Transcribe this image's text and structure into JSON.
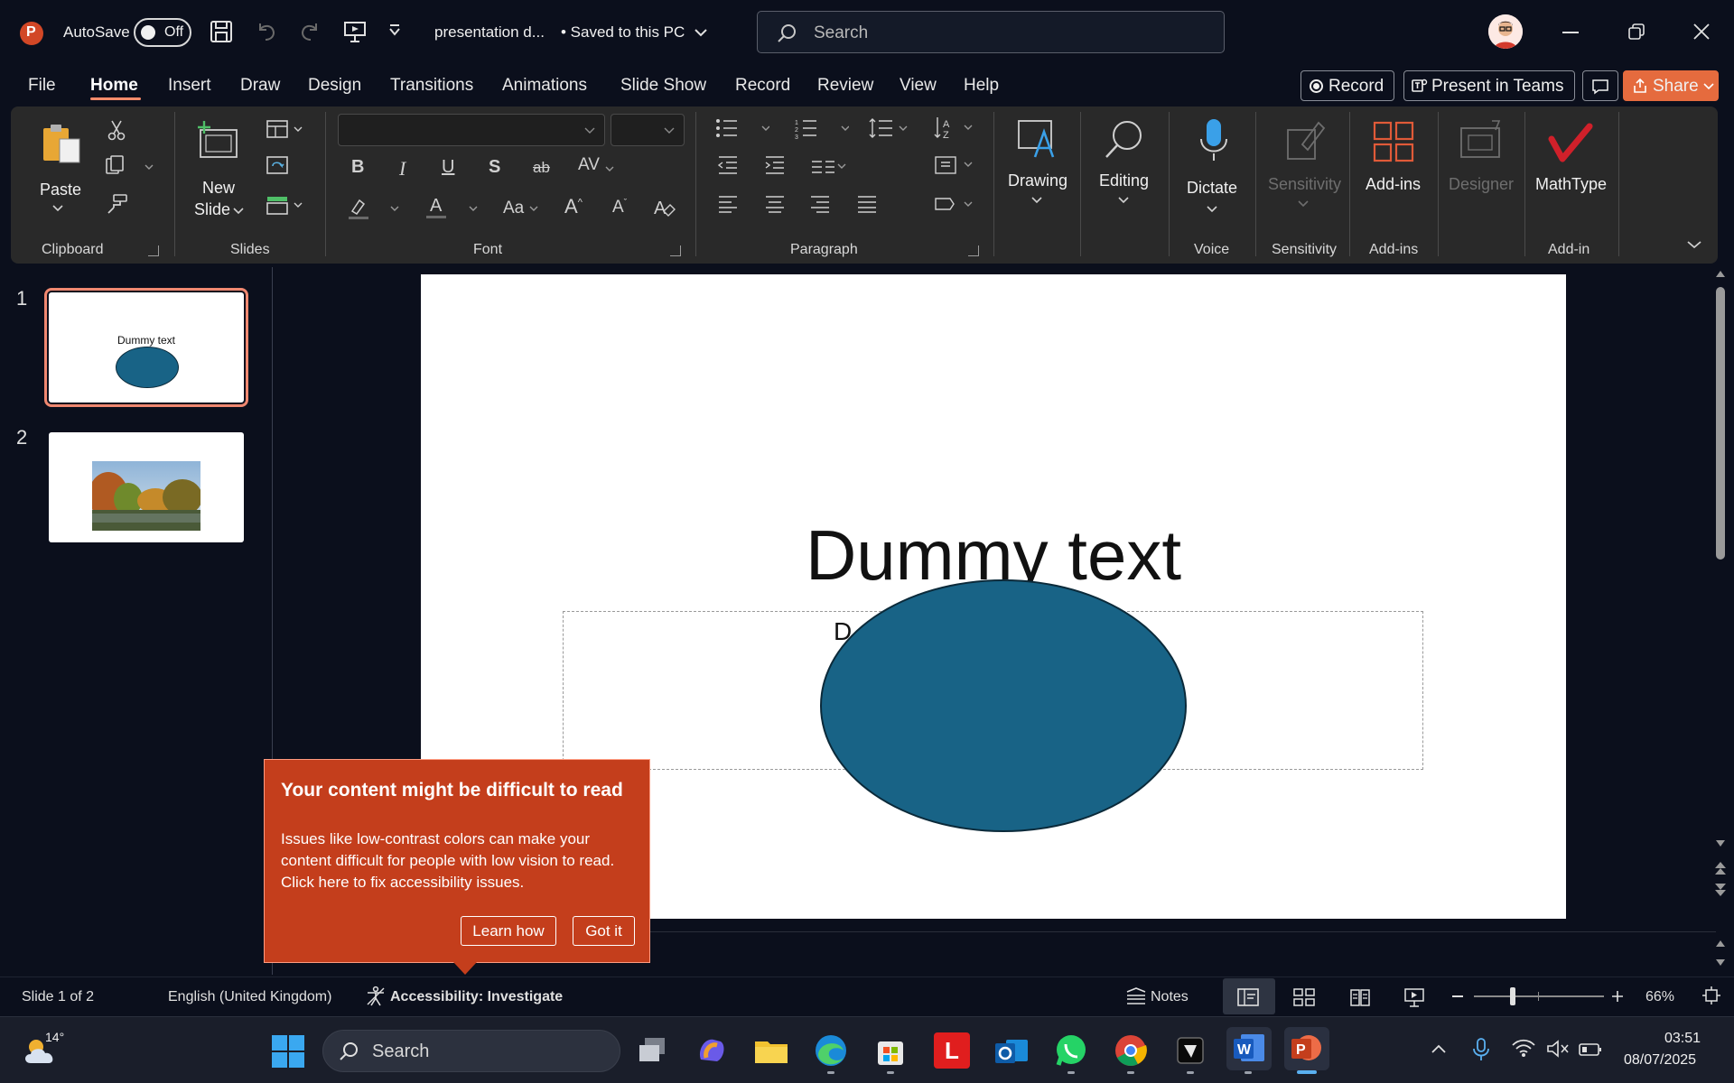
{
  "titlebar": {
    "autosave_label": "AutoSave",
    "autosave_state": "Off",
    "doc_title": "presentation d...",
    "save_status": "• Saved to this PC",
    "search_placeholder": "Search"
  },
  "menu": {
    "items": [
      "File",
      "Home",
      "Insert",
      "Draw",
      "Design",
      "Transitions",
      "Animations",
      "Slide Show",
      "Record",
      "Review",
      "View",
      "Help"
    ],
    "active": "Home",
    "record_button": "Record",
    "present_teams_button": "Present in Teams",
    "share_button": "Share"
  },
  "ribbon": {
    "paste": "Paste",
    "new_slide_line1": "New",
    "new_slide_line2": "Slide",
    "drawing": "Drawing",
    "editing": "Editing",
    "dictate": "Dictate",
    "sensitivity": "Sensitivity",
    "addins": "Add-ins",
    "designer": "Designer",
    "mathtype": "MathType",
    "groups": {
      "clipboard": "Clipboard",
      "slides": "Slides",
      "font": "Font",
      "paragraph": "Paragraph",
      "voice": "Voice",
      "sensitivity": "Sensitivity",
      "addins": "Add-ins",
      "addin": "Add-in"
    }
  },
  "thumbnails": [
    {
      "number": "1",
      "title": "Dummy text"
    },
    {
      "number": "2"
    }
  ],
  "slide": {
    "title": "Dummy text",
    "subtitle_fragment": "D"
  },
  "popup": {
    "title": "Your content might be difficult to read",
    "body": "Issues like low-contrast colors can make your content difficult for people with low vision to read. Click here to fix accessibility issues.",
    "learn_how": "Learn how",
    "got_it": "Got it"
  },
  "statusbar": {
    "slide_info": "Slide 1 of 2",
    "language": "English (United Kingdom)",
    "accessibility": "Accessibility: Investigate",
    "notes": "Notes",
    "zoom": "66%"
  },
  "taskbar": {
    "weather_temp": "14°",
    "search_placeholder": "Search",
    "time": "03:51",
    "date": "08/07/2025"
  },
  "colors": {
    "accent": "#c43e1c",
    "slide_shape": "#186386",
    "share_button": "#e56b3e"
  }
}
